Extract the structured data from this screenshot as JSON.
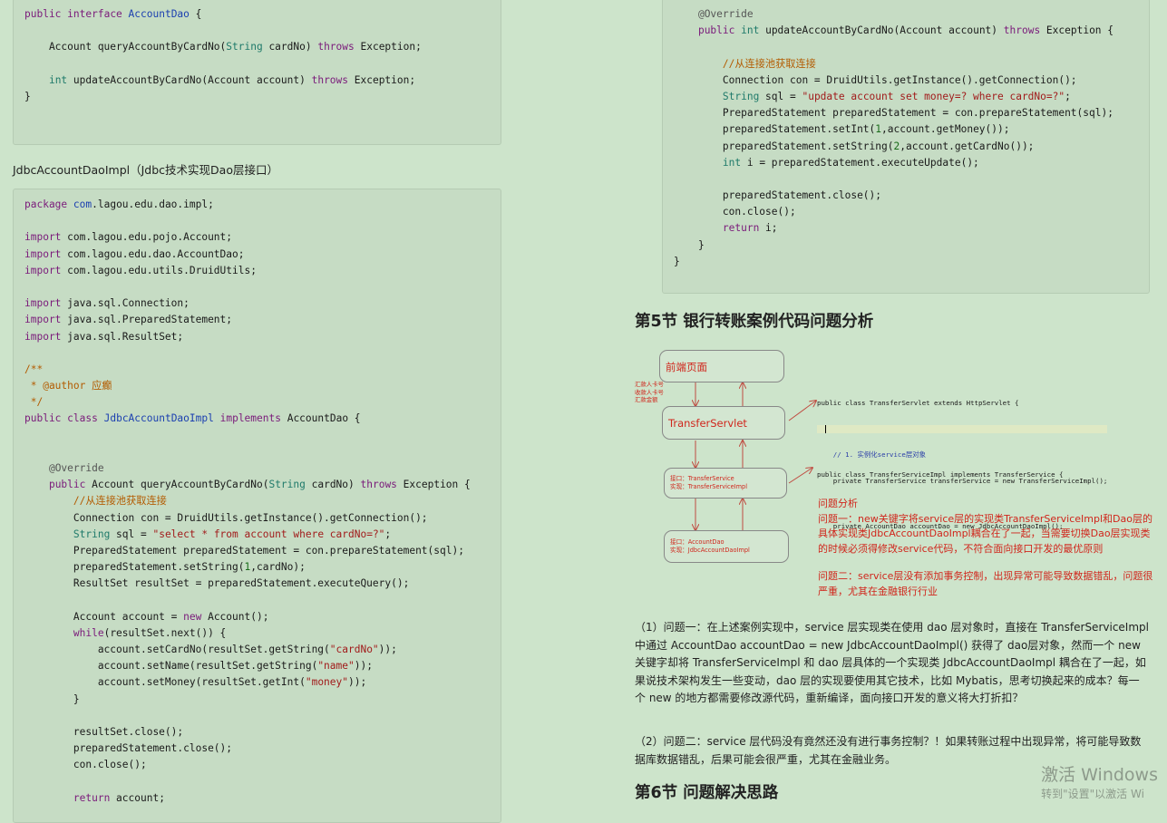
{
  "left": {
    "box1_lines": [
      "public interface AccountDao {",
      "",
      "    Account queryAccountByCardNo(String cardNo) throws Exception;",
      "",
      "    int updateAccountByCardNo(Account account) throws Exception;",
      "}"
    ],
    "caption": "JdbcAccountDaoImpl（Jdbc技术实现Dao层接口）",
    "box2_lines": [
      "package com.lagou.edu.dao.impl;",
      "",
      "import com.lagou.edu.pojo.Account;",
      "import com.lagou.edu.dao.AccountDao;",
      "import com.lagou.edu.utils.DruidUtils;",
      "",
      "import java.sql.Connection;",
      "import java.sql.PreparedStatement;",
      "import java.sql.ResultSet;",
      "",
      "/**",
      " * @author 应癫",
      " */",
      "public class JdbcAccountDaoImpl implements AccountDao {",
      "",
      "",
      "    @Override",
      "    public Account queryAccountByCardNo(String cardNo) throws Exception {",
      "        //从连接池获取连接",
      "        Connection con = DruidUtils.getInstance().getConnection();",
      "        String sql = \"select * from account where cardNo=?\";",
      "        PreparedStatement preparedStatement = con.prepareStatement(sql);",
      "        preparedStatement.setString(1,cardNo);",
      "        ResultSet resultSet = preparedStatement.executeQuery();",
      "",
      "        Account account = new Account();",
      "        while(resultSet.next()) {",
      "            account.setCardNo(resultSet.getString(\"cardNo\"));",
      "            account.setName(resultSet.getString(\"name\"));",
      "            account.setMoney(resultSet.getInt(\"money\"));",
      "        }",
      "",
      "        resultSet.close();",
      "        preparedStatement.close();",
      "        con.close();",
      "",
      "        return account;"
    ]
  },
  "right": {
    "box3_lines": [
      "    @Override",
      "    public int updateAccountByCardNo(Account account) throws Exception {",
      "",
      "        //从连接池获取连接",
      "        Connection con = DruidUtils.getInstance().getConnection();",
      "        String sql = \"update account set money=? where cardNo=?\";",
      "        PreparedStatement preparedStatement = con.prepareStatement(sql);",
      "        preparedStatement.setInt(1,account.getMoney());",
      "        preparedStatement.setString(2,account.getCardNo());",
      "        int i = preparedStatement.executeUpdate();",
      "",
      "        preparedStatement.close();",
      "        con.close();",
      "        return i;",
      "    }",
      "}"
    ],
    "section5_title": "第5节 银行转账案例代码问题分析",
    "diagram": {
      "node_frontend": "前端页面",
      "node_servlet": "TransferServlet",
      "node_service_line1": "接口：TransferService",
      "node_service_line2": "实现：TransferServiceImpl",
      "node_dao_line1": "接口：AccountDao",
      "node_dao_line2": "实现：JdbcAccountDaoImpl",
      "side_label_1": "汇款人卡号",
      "side_label_2": "收款人卡号",
      "side_label_3": "汇款金额",
      "code_servlet_line1": "public class TransferServlet extends HttpServlet {",
      "code_servlet_line2": "    // 1. 实例化service层对象",
      "code_servlet_line3": "    private TransferService transferService = new TransferServiceImpl();",
      "code_service_line1": "public class TransferServiceImpl implements TransferService {",
      "code_service_line2": "    private AccountDao accountDao = new JdbcAccountDaoImpl();",
      "analysis_title": "问题分析",
      "analysis_q1": "问题一：new关键字将service层的实现类TransferServiceImpl和Dao层的具体实现类JdbcAccountDaoImpl耦合在了一起，当需要切换Dao层实现类的时候必须得修改service代码，不符合面向接口开发的最优原则",
      "analysis_q2": "问题二：service层没有添加事务控制，出现异常可能导致数据错乱，问题很严重，尤其在金融银行行业"
    },
    "para1": "（1）问题一：在上述案例实现中，service 层实现类在使用 dao 层对象时，直接在 TransferServiceImpl 中通过 AccountDao accountDao = new JdbcAccountDaoImpl() 获得了 dao层对象，然而一个 new 关键字却将 TransferServiceImpl 和 dao 层具体的一个实现类 JdbcAccountDaoImpl 耦合在了一起，如果说技术架构发生一些变动，dao 层的实现要使用其它技术，比如 Mybatis，思考切换起来的成本？每一个 new 的地方都需要修改源代码，重新编译，面向接口开发的意义将大打折扣？",
    "para2": "（2）问题二：service 层代码没有竟然还没有进行事务控制？！如果转账过程中出现异常，将可能导致数据库数据错乱，后果可能会很严重，尤其在金融业务。",
    "section6_title": "第6节 问题解决思路"
  },
  "watermark": {
    "line1": "激活 Windows",
    "line2": "转到\"设置\"以激活 Wi"
  },
  "colors": {
    "page_bg": "#cde4cb",
    "code_bg": "#c6dcc4",
    "keyword": "#7a1a7a",
    "string": "#a11b1b",
    "comment": "#b35b00",
    "analysis_red": "#d0261c"
  }
}
